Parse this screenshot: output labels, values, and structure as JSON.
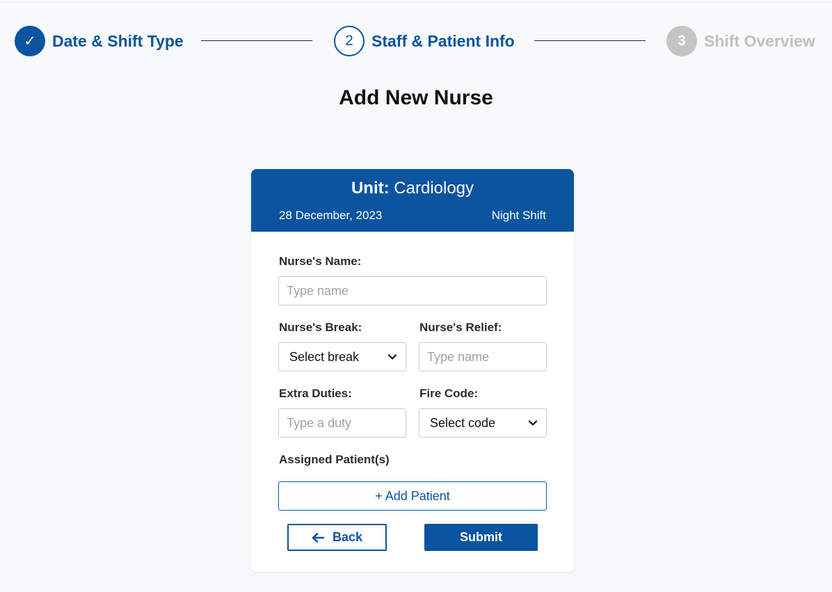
{
  "stepper": {
    "steps": [
      {
        "marker": "✓",
        "label": "Date & Shift Type",
        "state": "done"
      },
      {
        "marker": "2",
        "label": "Staff & Patient Info",
        "state": "active"
      },
      {
        "marker": "3",
        "label": "Shift Overview",
        "state": "pending"
      }
    ]
  },
  "page": {
    "title": "Add New Nurse"
  },
  "card": {
    "unit_key": "Unit:",
    "unit_value": "Cardiology",
    "date": "28 December, 2023",
    "shift": "Night Shift"
  },
  "form": {
    "name_label": "Nurse's Name:",
    "name_placeholder": "Type name",
    "name_value": "",
    "break_label": "Nurse's Break:",
    "break_selected": "Select break",
    "relief_label": "Nurse's Relief:",
    "relief_placeholder": "Type name",
    "relief_value": "",
    "duties_label": "Extra Duties:",
    "duties_placeholder": "Type a duty",
    "duties_value": "",
    "fire_label": "Fire Code:",
    "fire_selected": "Select code",
    "patients_label": "Assigned Patient(s)",
    "add_patient_label": "+ Add Patient"
  },
  "actions": {
    "back_label": "Back",
    "submit_label": "Submit"
  },
  "colors": {
    "primary": "#0a54a0",
    "pending": "#c4c4c4",
    "background": "#f8f9fb"
  },
  "icons": {
    "done": "check-icon",
    "select": "chevron-down-icon",
    "back": "arrow-left-icon"
  }
}
